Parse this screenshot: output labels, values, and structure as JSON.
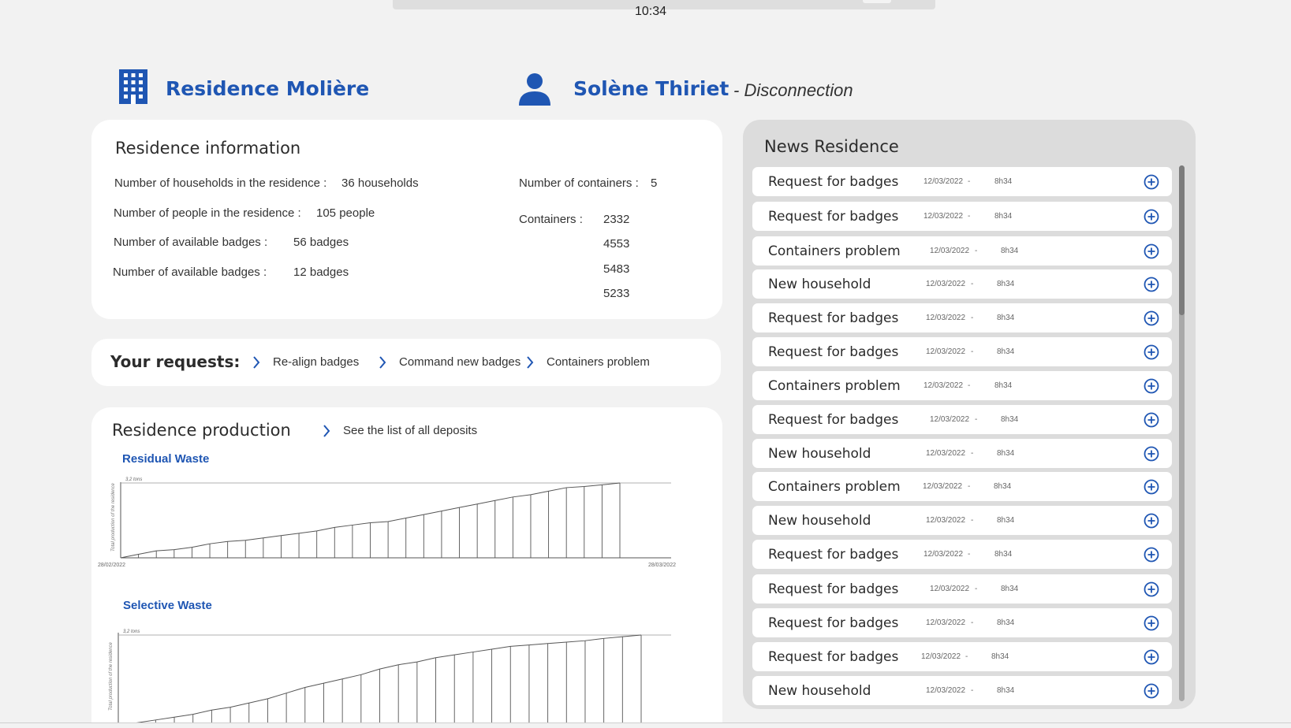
{
  "status_bar": {
    "time": "10:34"
  },
  "header": {
    "residence_name": "Residence Molière",
    "user_name": "Solène Thiriet",
    "disconnect_label": "-  Disconnection",
    "accent_color": "#1f56b3",
    "residence_icon": "building-icon",
    "user_icon": "user-icon"
  },
  "residence_info": {
    "title": "Residence information",
    "households_label": "Number of households in the residence :",
    "households_value": "36 households",
    "people_label": "Number of people in the residence :",
    "people_value": "105 people",
    "badges1_label": "Number of available badges :",
    "badges1_value": "56 badges",
    "badges2_label": "Number of available badges :",
    "badges2_value": "12 badges",
    "containers_count_label": "Number of containers :",
    "containers_count_value": "5",
    "containers_label": "Containers :",
    "containers": [
      "2332",
      "4553",
      "5483",
      "5233"
    ]
  },
  "requests": {
    "title": "Your requests:",
    "links": [
      "Re-align badges",
      "Command new badges",
      "Containers problem"
    ]
  },
  "production": {
    "title": "Residence production",
    "deposits_link": "See the list of all deposits"
  },
  "chart_data": [
    {
      "type": "line",
      "title": "Residual Waste",
      "ylabel": "Total production of the residence",
      "reference_line": "3,2 tons",
      "x_start_label": "28/02/2022",
      "x_end_label": "28/03/2022",
      "x": [
        0,
        1,
        2,
        3,
        4,
        5,
        6,
        7,
        8,
        9,
        10,
        11,
        12,
        13,
        14,
        15,
        16,
        17,
        18,
        19,
        20,
        21,
        22,
        23,
        24,
        25,
        26,
        27,
        28
      ],
      "y": [
        0,
        0.15,
        0.3,
        0.35,
        0.45,
        0.6,
        0.7,
        0.75,
        0.85,
        0.95,
        1.05,
        1.15,
        1.3,
        1.4,
        1.5,
        1.55,
        1.7,
        1.85,
        2.0,
        2.15,
        2.3,
        2.45,
        2.6,
        2.7,
        2.85,
        3.0,
        3.05,
        3.12,
        3.2
      ]
    },
    {
      "type": "line",
      "title": "Selective Waste",
      "ylabel": "Total production of the residence",
      "reference_line": "3,2 tons",
      "x": [
        0,
        1,
        2,
        3,
        4,
        5,
        6,
        7,
        8,
        9,
        10,
        11,
        12,
        13,
        14,
        15,
        16,
        17,
        18,
        19,
        20,
        21,
        22,
        23,
        24,
        25,
        26,
        27,
        28
      ],
      "y": [
        0,
        0.1,
        0.2,
        0.3,
        0.4,
        0.55,
        0.65,
        0.8,
        0.95,
        1.15,
        1.35,
        1.5,
        1.65,
        1.8,
        2.0,
        2.15,
        2.25,
        2.4,
        2.5,
        2.6,
        2.7,
        2.8,
        2.85,
        2.9,
        2.95,
        3.0,
        3.08,
        3.14,
        3.2
      ]
    }
  ],
  "news": {
    "title": "News Residence",
    "items": [
      {
        "label": "Request for badges",
        "date": "12/03/2022",
        "sep": "-",
        "time": "8h34"
      },
      {
        "label": "Request for badges",
        "date": "12/03/2022",
        "sep": "-",
        "time": "8h34"
      },
      {
        "label": "Containers problem",
        "date": "12/03/2022",
        "sep": "-",
        "time": "8h34"
      },
      {
        "label": "New household",
        "date": "12/03/2022",
        "sep": "-",
        "time": "8h34"
      },
      {
        "label": "Request for badges",
        "date": "12/03/2022",
        "sep": "-",
        "time": "8h34"
      },
      {
        "label": "Request for badges",
        "date": "12/03/2022",
        "sep": "-",
        "time": "8h34"
      },
      {
        "label": "Containers problem",
        "date": "12/03/2022",
        "sep": "-",
        "time": "8h34"
      },
      {
        "label": "Request for badges",
        "date": "12/03/2022",
        "sep": "-",
        "time": "8h34"
      },
      {
        "label": "New household",
        "date": "12/03/2022",
        "sep": "-",
        "time": "8h34"
      },
      {
        "label": "Containers problem",
        "date": "12/03/2022",
        "sep": "-",
        "time": "8h34"
      },
      {
        "label": "New household",
        "date": "12/03/2022",
        "sep": "-",
        "time": "8h34"
      },
      {
        "label": "Request for badges",
        "date": "12/03/2022",
        "sep": "-",
        "time": "8h34"
      },
      {
        "label": "Request for badges",
        "date": "12/03/2022",
        "sep": "-",
        "time": "8h34"
      },
      {
        "label": "Request for badges",
        "date": "12/03/2022",
        "sep": "-",
        "time": "8h34"
      },
      {
        "label": "Request for badges",
        "date": "12/03/2022",
        "sep": "-",
        "time": "8h34"
      },
      {
        "label": "New household",
        "date": "12/03/2022",
        "sep": "-",
        "time": "8h34"
      }
    ],
    "item_icon": "plus-circle-icon"
  }
}
